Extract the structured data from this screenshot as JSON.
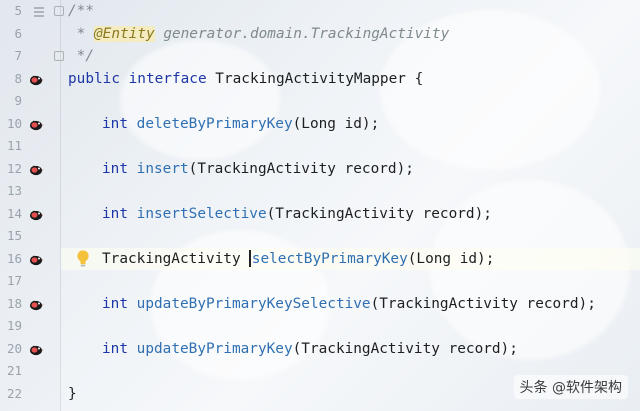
{
  "editor": {
    "lines": [
      {
        "num": "5",
        "type": "comment_start",
        "text": "/**"
      },
      {
        "num": "6",
        "type": "comment_entity",
        "star": " * ",
        "annotation": "@Entity",
        "rest": " generator.domain.TrackingActivity"
      },
      {
        "num": "7",
        "type": "comment_end",
        "text": " */"
      },
      {
        "num": "8",
        "type": "decl",
        "kw": "public interface ",
        "name": "TrackingActivityMapper",
        "rest": " {"
      },
      {
        "num": "9",
        "type": "blank"
      },
      {
        "num": "10",
        "type": "method",
        "ret": "int",
        "name": "deleteByPrimaryKey",
        "args": "(Long id);"
      },
      {
        "num": "11",
        "type": "blank"
      },
      {
        "num": "12",
        "type": "method",
        "ret": "int",
        "name": "insert",
        "args": "(TrackingActivity record);"
      },
      {
        "num": "13",
        "type": "blank"
      },
      {
        "num": "14",
        "type": "method",
        "ret": "int",
        "name": "insertSelective",
        "args": "(TrackingActivity record);"
      },
      {
        "num": "15",
        "type": "blank"
      },
      {
        "num": "16",
        "type": "method_cursor",
        "ret": "TrackingActivity",
        "name": "selectByPrimaryKey",
        "args": "(Long id);"
      },
      {
        "num": "17",
        "type": "blank"
      },
      {
        "num": "18",
        "type": "method",
        "ret": "int",
        "name": "updateByPrimaryKeySelective",
        "args": "(TrackingActivity record);"
      },
      {
        "num": "19",
        "type": "blank"
      },
      {
        "num": "20",
        "type": "method",
        "ret": "int",
        "name": "updateByPrimaryKey",
        "args": "(TrackingActivity record);"
      },
      {
        "num": "21",
        "type": "blank"
      },
      {
        "num": "22",
        "type": "close",
        "text": "}"
      }
    ],
    "gutter_icon": "mybatis-bird-icon",
    "colors": {
      "keyword": "#1e37a8",
      "method": "#2f6fb2",
      "comment": "#7f8a8f",
      "annotation": "#8b7a20"
    }
  },
  "watermark": {
    "text": "头条 @软件架构"
  }
}
